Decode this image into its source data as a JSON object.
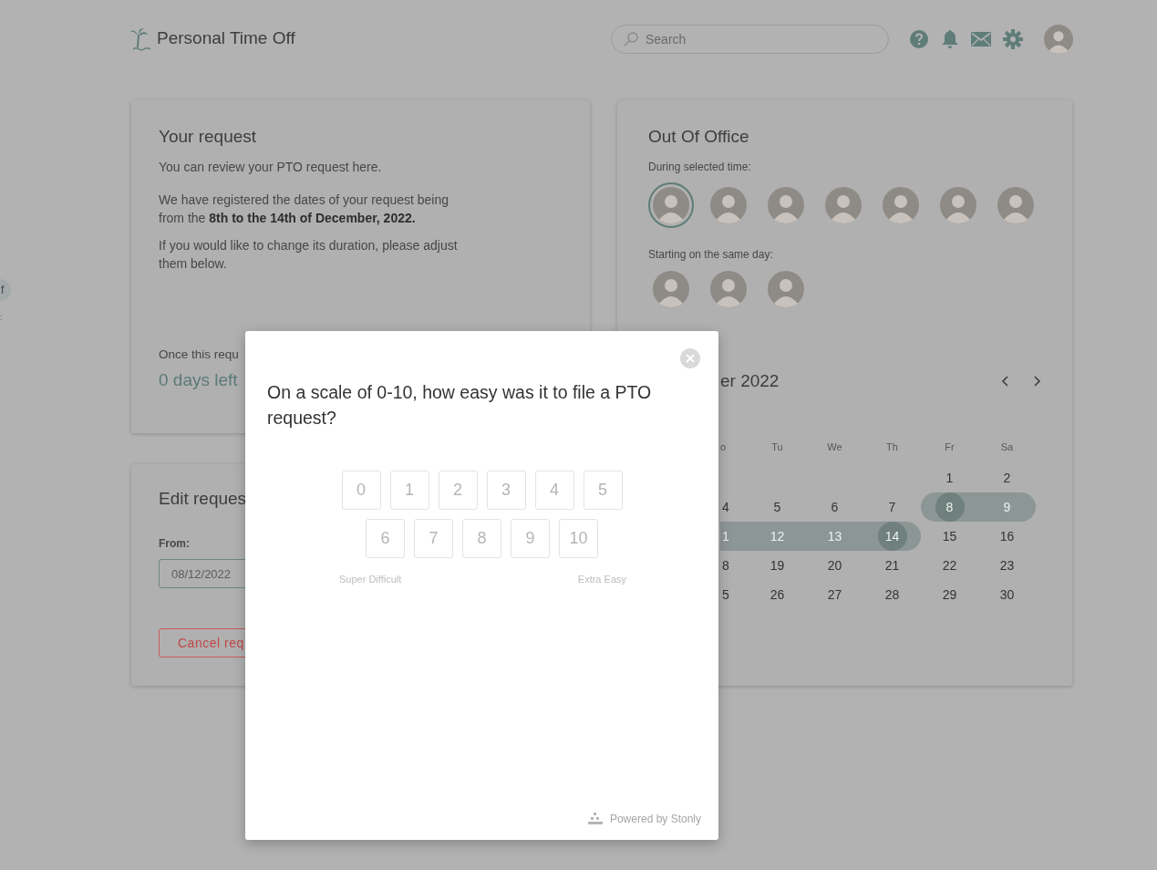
{
  "header": {
    "title": "Personal Time Off",
    "search": {
      "placeholder": "Search"
    }
  },
  "sidebar_items": [
    {
      "label": "f"
    },
    {
      "label": ":"
    }
  ],
  "request_card": {
    "title": "Your request",
    "paragraphs": [
      "You can review your PTO request here.",
      "We have registered the dates of your request being from the **8th to the 14th of December, 2022.**",
      "If you would like to change its duration, please adjust them below."
    ],
    "note": "Once this requ",
    "days_left": "0 days left"
  },
  "edit_card": {
    "title": "Edit reques",
    "from_label": "From:",
    "from_value": "08/12/2022",
    "cancel_button": "Cancel req"
  },
  "out_of_office": {
    "title": "Out Of Office",
    "during_label": "During selected time:",
    "during_avatars": [
      {
        "selected": true
      },
      {
        "selected": false
      },
      {
        "selected": false
      },
      {
        "selected": false
      },
      {
        "selected": false
      },
      {
        "selected": false
      },
      {
        "selected": false
      }
    ],
    "same_day_label": "Starting on the same day:",
    "same_day_avatars": [
      {
        "selected": false
      },
      {
        "selected": false
      },
      {
        "selected": false
      }
    ]
  },
  "calendar": {
    "month": "er 2022",
    "weekdays": [
      "o",
      "Tu",
      "We",
      "Th",
      "Fr",
      "Sa"
    ],
    "weeks": [
      [
        {
          "label": "1",
          "in_range": false,
          "endpoint": false
        },
        {
          "label": "2",
          "in_range": false,
          "endpoint": false
        }
      ],
      [
        {
          "label": "4",
          "in_range": false,
          "endpoint": false
        },
        {
          "label": "5",
          "in_range": false,
          "endpoint": false
        },
        {
          "label": "6",
          "in_range": false,
          "endpoint": false
        },
        {
          "label": "7",
          "in_range": false,
          "endpoint": false
        },
        {
          "label": "8",
          "in_range": true,
          "endpoint": true
        },
        {
          "label": "9",
          "in_range": true,
          "endpoint": false
        }
      ],
      [
        {
          "label": "1",
          "in_range": true,
          "endpoint": false
        },
        {
          "label": "12",
          "in_range": true,
          "endpoint": false
        },
        {
          "label": "13",
          "in_range": true,
          "endpoint": false
        },
        {
          "label": "14",
          "in_range": true,
          "endpoint": true
        },
        {
          "label": "15",
          "in_range": false,
          "endpoint": false
        },
        {
          "label": "16",
          "in_range": false,
          "endpoint": false
        }
      ],
      [
        {
          "label": "8",
          "in_range": false,
          "endpoint": false
        },
        {
          "label": "19",
          "in_range": false,
          "endpoint": false
        },
        {
          "label": "20",
          "in_range": false,
          "endpoint": false
        },
        {
          "label": "21",
          "in_range": false,
          "endpoint": false
        },
        {
          "label": "22",
          "in_range": false,
          "endpoint": false
        },
        {
          "label": "23",
          "in_range": false,
          "endpoint": false
        }
      ],
      [
        {
          "label": "5",
          "in_range": false,
          "endpoint": false
        },
        {
          "label": "26",
          "in_range": false,
          "endpoint": false
        },
        {
          "label": "27",
          "in_range": false,
          "endpoint": false
        },
        {
          "label": "28",
          "in_range": false,
          "endpoint": false
        },
        {
          "label": "29",
          "in_range": false,
          "endpoint": false
        },
        {
          "label": "30",
          "in_range": false,
          "endpoint": false
        }
      ]
    ]
  },
  "survey": {
    "question": "On a scale of 0-10, how easy was it to file a PTO request?",
    "option_rows": [
      [
        "0",
        "1",
        "2",
        "3",
        "4",
        "5"
      ],
      [
        "6",
        "7",
        "8",
        "9",
        "10"
      ]
    ],
    "low_label": "Super Difficult",
    "high_label": "Extra Easy",
    "footer": "Powered by Stonly"
  }
}
